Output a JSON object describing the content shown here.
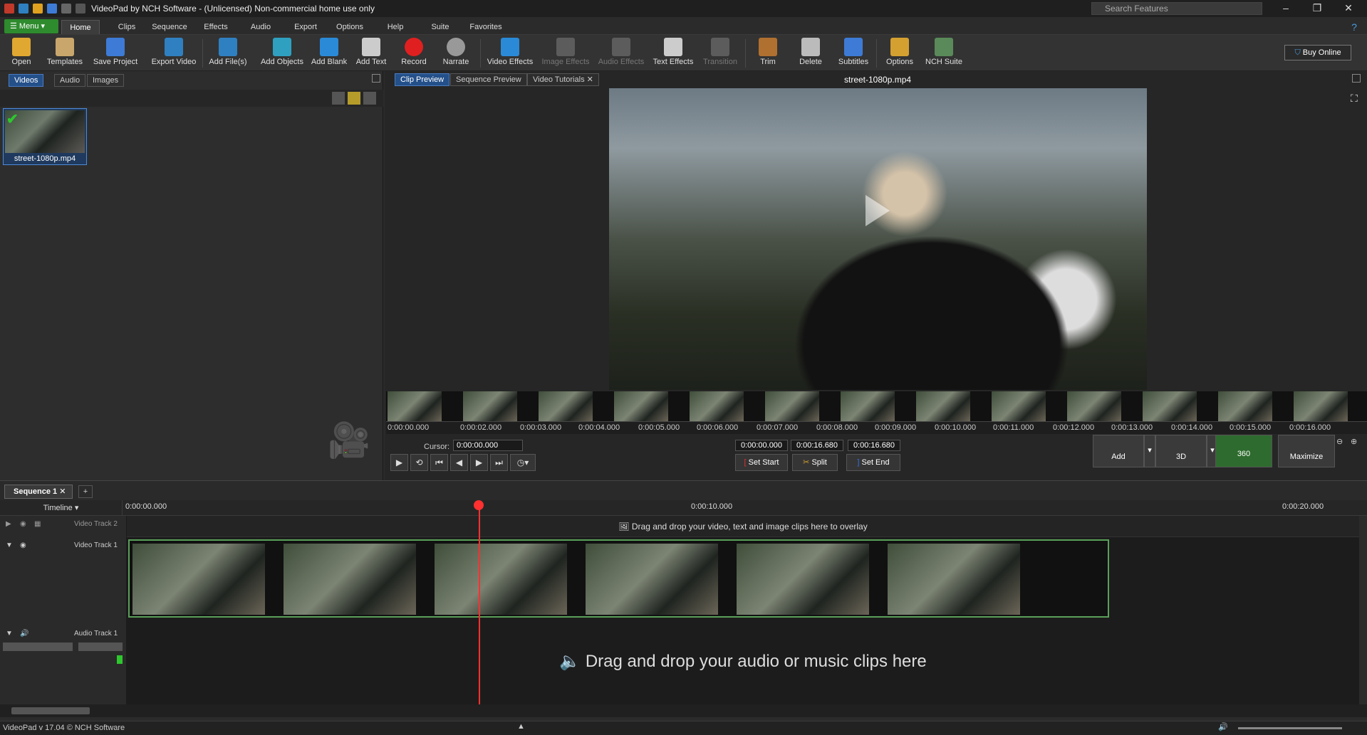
{
  "window": {
    "title": "VideoPad by NCH Software - (Unlicensed) Non-commercial home use only",
    "search_placeholder": "Search Features"
  },
  "menubar": {
    "menu_label": "Menu",
    "tabs": [
      "Home",
      "Clips",
      "Sequence",
      "Effects",
      "Audio",
      "Export",
      "Options",
      "Help",
      "Suite",
      "Favorites"
    ],
    "active_tab": "Home"
  },
  "toolbar": {
    "items": [
      {
        "label": "Open",
        "icon": "folder-open-icon"
      },
      {
        "label": "Templates",
        "icon": "templates-icon"
      },
      {
        "label": "Save Project",
        "icon": "save-icon"
      },
      {
        "label": "Export Video",
        "icon": "export-icon"
      },
      {
        "label": "Add File(s)",
        "icon": "add-file-icon"
      },
      {
        "label": "Add Objects",
        "icon": "add-objects-icon"
      },
      {
        "label": "Add Blank",
        "icon": "add-blank-icon"
      },
      {
        "label": "Add Text",
        "icon": "text-icon"
      },
      {
        "label": "Record",
        "icon": "record-icon"
      },
      {
        "label": "Narrate",
        "icon": "microphone-icon"
      },
      {
        "label": "Video Effects",
        "icon": "video-effects-icon"
      },
      {
        "label": "Image Effects",
        "icon": "image-effects-icon",
        "disabled": true
      },
      {
        "label": "Audio Effects",
        "icon": "audio-effects-icon",
        "disabled": true
      },
      {
        "label": "Text Effects",
        "icon": "text-effects-icon"
      },
      {
        "label": "Transition",
        "icon": "transition-icon",
        "disabled": true
      },
      {
        "label": "Trim",
        "icon": "trim-icon"
      },
      {
        "label": "Delete",
        "icon": "trash-icon"
      },
      {
        "label": "Subtitles",
        "icon": "subtitles-icon"
      },
      {
        "label": "Options",
        "icon": "options-icon"
      },
      {
        "label": "NCH Suite",
        "icon": "suite-icon"
      }
    ],
    "buy_online": "Buy Online"
  },
  "bin": {
    "tabs": [
      "Videos",
      "Audio",
      "Images"
    ],
    "active_tab": "Videos",
    "items": [
      {
        "name": "street-1080p.mp4"
      }
    ]
  },
  "preview": {
    "tabs": [
      "Clip Preview",
      "Sequence Preview",
      "Video Tutorials"
    ],
    "active_tab": "Clip Preview",
    "filename": "street-1080p.mp4",
    "ruler_ticks": [
      "0:00:00.000",
      "0:00:02.000",
      "0:00:03.000",
      "0:00:04.000",
      "0:00:05.000",
      "0:00:06.000",
      "0:00:07.000",
      "0:00:08.000",
      "0:00:09.000",
      "0:00:10.000",
      "0:00:11.000",
      "0:00:12.000",
      "0:00:13.000",
      "0:00:14.000",
      "0:00:15.000",
      "0:00:16.000"
    ],
    "cursor_label": "Cursor:",
    "cursor_value": "0:00:00.000",
    "set_start_value": "0:00:00.000",
    "duration_value": "0:00:16.680",
    "set_end_value": "0:00:16.680",
    "buttons": {
      "set_start": "Set Start",
      "split": "Split",
      "set_end": "Set End",
      "add": "Add",
      "three_d": "3D",
      "three_sixty": "360",
      "maximize": "Maximize"
    }
  },
  "sequence": {
    "tab_label": "Sequence 1",
    "timeline_label": "Timeline",
    "time_marks": [
      "0:00:00.000",
      "0:00:10.000",
      "0:00:20.000"
    ],
    "video_track_2": "Video Track 2",
    "video_track_1": "Video Track 1",
    "audio_track_1": "Audio Track 1",
    "overlay_hint": "Drag and drop your video, text and image clips here to overlay",
    "audio_hint": "Drag and drop your audio or music clips here"
  },
  "status": {
    "text": "VideoPad v 17.04 © NCH Software"
  },
  "colors": {
    "accent": "#2e8b2e",
    "selected_tab": "#24508a",
    "playhead": "#ff3030"
  }
}
